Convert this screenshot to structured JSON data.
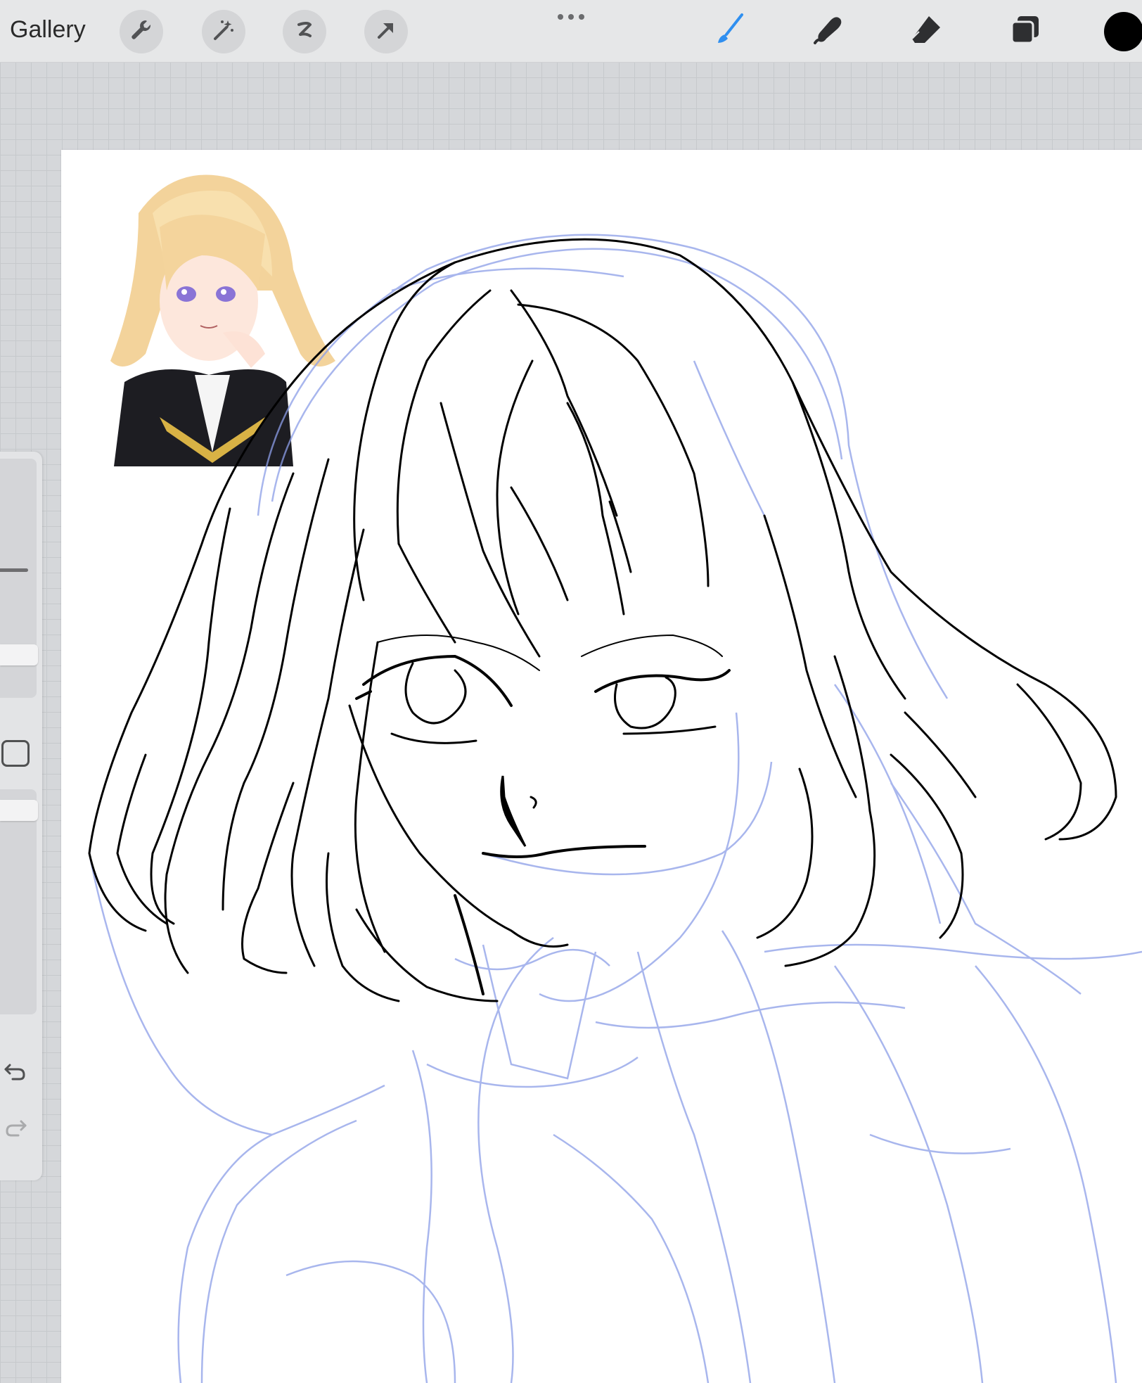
{
  "toolbar": {
    "gallery_label": "Gallery",
    "left_tools": [
      "wrench-icon",
      "magic-wand-icon",
      "selection-icon",
      "transform-arrow-icon"
    ],
    "right_tools": [
      "brush-icon",
      "smudge-icon",
      "eraser-icon",
      "layers-icon"
    ],
    "active_tool": "brush",
    "accent_color": "#2f8ff0",
    "current_color": "#000000"
  },
  "sidebar": {
    "controls": [
      "brush-size-slider",
      "modify-button",
      "opacity-slider",
      "undo-button",
      "redo-button"
    ],
    "brush_size_level": 0.15,
    "opacity_level": 0.05
  },
  "canvas": {
    "background": "#ffffff",
    "sketch_color": "#8c9ee8",
    "lineart_color": "#000000",
    "reference_image": "anime-girl-blonde-hair-reference"
  }
}
